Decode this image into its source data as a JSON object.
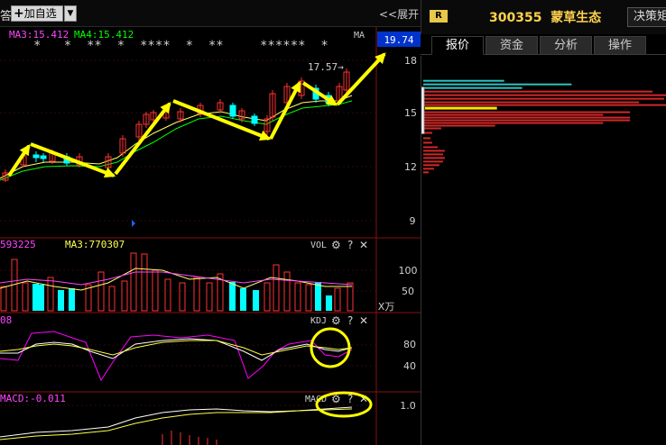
{
  "toolbar": {
    "left_fragment": "答",
    "add_watchlist_label": "加自选",
    "dropdown_glyph": "▼",
    "expand_label": "<<展开",
    "expand_box_value": "19.74"
  },
  "main_chart": {
    "ma3_label": "MA3:15.412",
    "ma4_label": "MA4:15.412",
    "ma_tag": "MA",
    "price_annotation": "17.57→",
    "price_axis": [
      "18",
      "15",
      "12",
      "9"
    ],
    "star_rows": [
      "*   *  **  *  ****  *  **",
      "******  *"
    ]
  },
  "vol_panel": {
    "left_label": "593225",
    "ma_label": "MA3:770307",
    "name": "VOL",
    "axis": [
      "100",
      "50"
    ],
    "unit": "X万"
  },
  "kdj_panel": {
    "left_label": "08",
    "name": "KDJ",
    "axis": [
      "80",
      "40"
    ]
  },
  "macd_panel": {
    "left_label": "MACD:-0.011",
    "name": "MACD",
    "axis": [
      "1.0"
    ]
  },
  "panel_icons": {
    "settings": "⚙",
    "help": "?",
    "close": "✕"
  },
  "stock": {
    "badge": "R",
    "code": "300355",
    "name": "蒙草生态",
    "decision_button": "决策矩"
  },
  "tabs": [
    "报价",
    "资金",
    "分析",
    "操作"
  ],
  "colors": {
    "up": "#ff3232",
    "down": "#00ffff",
    "ma_yellow": "#ffff00",
    "ma_green": "#00ff00",
    "kdj_magenta": "#ff00ff",
    "price_box": "#0033cc",
    "stock_title": "#ffd24c",
    "annotation_arrow": "#ffff00",
    "highlight_circle": "#ffff00"
  }
}
